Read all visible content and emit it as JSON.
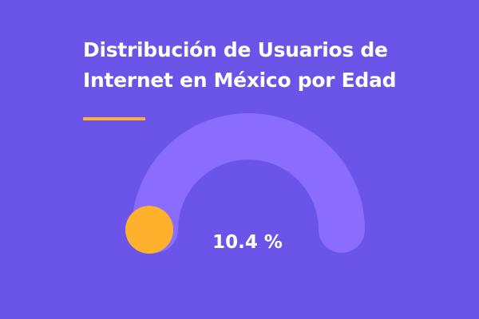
{
  "title_lines": [
    "Distribución de Usuarios de",
    "Internet en México por Edad"
  ],
  "colors": {
    "background": "#6a55e8",
    "track": "#8a6dff",
    "indicator": "#ffb12e",
    "text": "#ffffff"
  },
  "chart_data": {
    "type": "gauge",
    "title": "Distribución de Usuarios de Internet en México por Edad",
    "value": 10.4,
    "value_label": "10.4 %",
    "unit": "%",
    "range": [
      0,
      100
    ]
  }
}
